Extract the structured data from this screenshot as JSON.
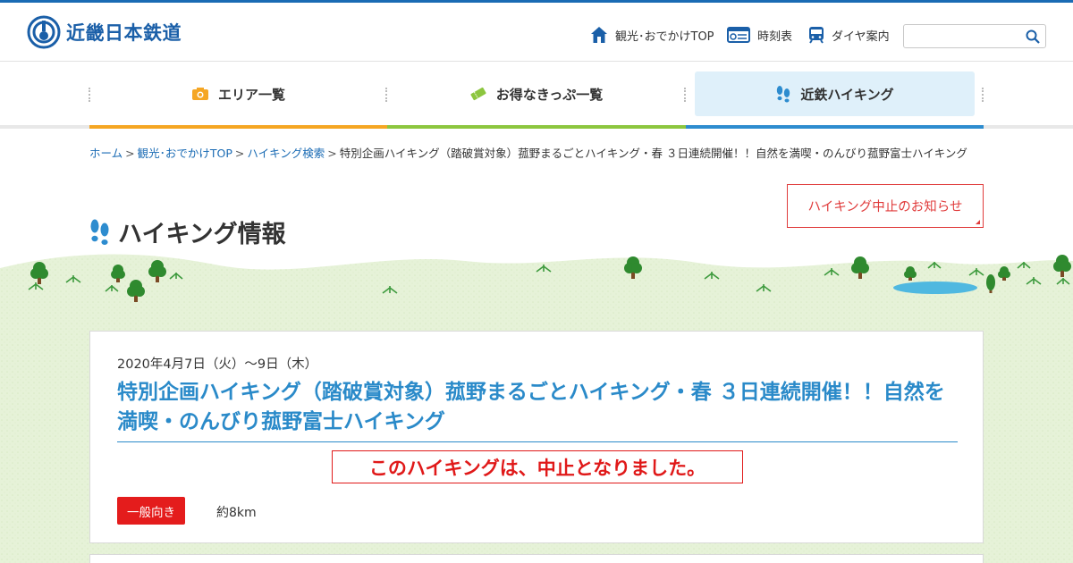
{
  "header": {
    "logo_text": "近畿日本鉄道",
    "nav": [
      {
        "label": "観光･おでかけTOP",
        "icon": "home-icon"
      },
      {
        "label": "時刻表",
        "icon": "timetable-icon"
      },
      {
        "label": "ダイヤ案内",
        "icon": "train-icon"
      }
    ],
    "search": {
      "placeholder": "",
      "value": ""
    }
  },
  "gnav": {
    "items": [
      {
        "label": "エリア一覧",
        "icon": "camera-icon"
      },
      {
        "label": "お得なきっぷ一覧",
        "icon": "ticket-icon"
      },
      {
        "label": "近鉄ハイキング",
        "icon": "footprints-icon"
      }
    ]
  },
  "breadcrumb": {
    "items": [
      "ホーム",
      "観光･おでかけTOP",
      "ハイキング検索"
    ],
    "separator": ">",
    "current": "特別企画ハイキング（踏破賞対象）菰野まるごとハイキング・春 ３日連続開催！！自然を満喫・のんびり菰野富士ハイキング"
  },
  "notice_button": "ハイキング中止のお知らせ",
  "page_title": "ハイキング情報",
  "event": {
    "date": "2020年4月7日（火）～9日（木）",
    "title": "特別企画ハイキング（踏破賞対象）菰野まるごとハイキング・春 ３日連続開催！！自然を満喫・のんびり菰野富士ハイキング",
    "cancel_notice": "このハイキングは、中止となりました。",
    "level": "一般向き",
    "distance": "約8km"
  },
  "colors": {
    "brand": "#1a5fa8",
    "link": "#1a6bb4",
    "title_blue": "#2a8ac9",
    "alert_red": "#e01919",
    "nav_orange": "#f5a623",
    "nav_green": "#8cc63f",
    "nav_blue": "#2d8ccf",
    "grass": "#e6f2d8"
  }
}
